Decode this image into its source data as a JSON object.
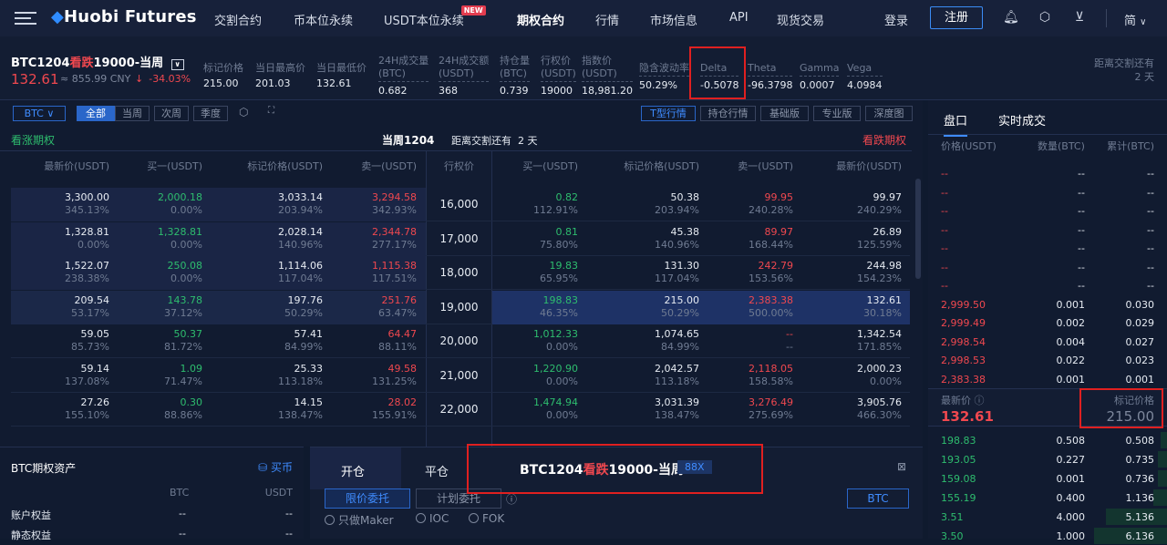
{
  "nav": {
    "logo": "Huobi Futures",
    "items": [
      "交割合约",
      "币本位永续",
      "USDT本位永续",
      "期权合约",
      "行情",
      "市场信息",
      "API",
      "现货交易"
    ],
    "new_badge": "NEW",
    "login": "登录",
    "register": "注册",
    "lang": "简"
  },
  "info": {
    "symbol_prefix": "BTC1204",
    "symbol_type": "看跌",
    "symbol_suffix": "19000-当周",
    "price": "132.61",
    "cny": "≈ 855.99 CNY",
    "change": "-34.03%",
    "stats": [
      {
        "label": "标记价格",
        "value": "215.00"
      },
      {
        "label": "当日最高价",
        "value": "201.03"
      },
      {
        "label": "当日最低价",
        "value": "132.61"
      },
      {
        "label": "24H成交量",
        "label2": "(BTC)",
        "value": "0.682"
      },
      {
        "label": "24H成交额",
        "label2": "(USDT)",
        "value": "368"
      },
      {
        "label": "持仓量",
        "label2": "(BTC)",
        "value": "0.739"
      },
      {
        "label": "行权价",
        "label2": "(USDT)",
        "value": "19000"
      },
      {
        "label": "指数价",
        "label2": "(USDT)",
        "value": "18,981.20"
      },
      {
        "label": "隐含波动率",
        "value": "50.29%"
      },
      {
        "label": "Delta",
        "value": "-0.5078"
      },
      {
        "label": "Theta",
        "value": "-96.3798"
      },
      {
        "label": "Gamma",
        "value": "0.0007"
      },
      {
        "label": "Vega",
        "value": "4.0984"
      }
    ],
    "dist_label": "距离交割还有",
    "dist_value": "2 天"
  },
  "filters": {
    "asset": "BTC",
    "periods": [
      "全部",
      "当周",
      "次周",
      "季度"
    ],
    "views": [
      "T型行情",
      "持仓行情",
      "基础版",
      "专业版",
      "深度图"
    ]
  },
  "board": {
    "call_title": "看涨期权",
    "put_title": "看跌期权",
    "center_title": "当周1204",
    "center_dist": "距离交割还有",
    "center_days": "2 天",
    "headers_left": [
      "最新价(USDT)",
      "买一(USDT)",
      "标记价格(USDT)",
      "卖一(USDT)"
    ],
    "header_strike": "行权价",
    "headers_right": [
      "买一(USDT)",
      "标记价格(USDT)",
      "卖一(USDT)",
      "最新价(USDT)"
    ],
    "rows": [
      {
        "strike": "16,000",
        "c": [
          [
            "3,300.00",
            "345.13%"
          ],
          [
            "2,000.18",
            "0.00%"
          ],
          [
            "3,033.14",
            "203.94%"
          ],
          [
            "3,294.58",
            "342.93%"
          ]
        ],
        "p": [
          [
            "0.82",
            "112.91%"
          ],
          [
            "50.38",
            "203.94%"
          ],
          [
            "99.95",
            "240.28%"
          ],
          [
            "99.97",
            "240.29%"
          ]
        ]
      },
      {
        "strike": "17,000",
        "c": [
          [
            "1,328.81",
            "0.00%"
          ],
          [
            "1,328.81",
            "0.00%"
          ],
          [
            "2,028.14",
            "140.96%"
          ],
          [
            "2,344.78",
            "277.17%"
          ]
        ],
        "p": [
          [
            "0.81",
            "75.80%"
          ],
          [
            "45.38",
            "140.96%"
          ],
          [
            "89.97",
            "168.44%"
          ],
          [
            "26.89",
            "125.59%"
          ]
        ]
      },
      {
        "strike": "18,000",
        "c": [
          [
            "1,522.07",
            "238.38%"
          ],
          [
            "250.08",
            "0.00%"
          ],
          [
            "1,114.06",
            "117.04%"
          ],
          [
            "1,115.38",
            "117.51%"
          ]
        ],
        "p": [
          [
            "19.83",
            "65.95%"
          ],
          [
            "131.30",
            "117.04%"
          ],
          [
            "242.79",
            "153.56%"
          ],
          [
            "244.98",
            "154.23%"
          ]
        ]
      },
      {
        "strike": "19,000",
        "c": [
          [
            "209.54",
            "53.17%"
          ],
          [
            "143.78",
            "37.12%"
          ],
          [
            "197.76",
            "50.29%"
          ],
          [
            "251.76",
            "63.47%"
          ]
        ],
        "p": [
          [
            "198.83",
            "46.35%"
          ],
          [
            "215.00",
            "50.29%"
          ],
          [
            "2,383.38",
            "500.00%"
          ],
          [
            "132.61",
            "30.18%"
          ]
        ]
      },
      {
        "strike": "20,000",
        "c": [
          [
            "59.05",
            "85.73%"
          ],
          [
            "50.37",
            "81.72%"
          ],
          [
            "57.41",
            "84.99%"
          ],
          [
            "64.47",
            "88.11%"
          ]
        ],
        "p": [
          [
            "1,012.33",
            "0.00%"
          ],
          [
            "1,074.65",
            "84.99%"
          ],
          [
            "--",
            "--"
          ],
          [
            "1,342.54",
            "171.85%"
          ]
        ]
      },
      {
        "strike": "21,000",
        "c": [
          [
            "59.14",
            "137.08%"
          ],
          [
            "1.09",
            "71.47%"
          ],
          [
            "25.33",
            "113.18%"
          ],
          [
            "49.58",
            "131.25%"
          ]
        ],
        "p": [
          [
            "1,220.90",
            "0.00%"
          ],
          [
            "2,042.57",
            "113.18%"
          ],
          [
            "2,118.05",
            "158.58%"
          ],
          [
            "2,000.23",
            "0.00%"
          ]
        ]
      },
      {
        "strike": "22,000",
        "c": [
          [
            "27.26",
            "155.10%"
          ],
          [
            "0.30",
            "88.86%"
          ],
          [
            "14.15",
            "138.47%"
          ],
          [
            "28.02",
            "155.91%"
          ]
        ],
        "p": [
          [
            "1,474.94",
            "0.00%"
          ],
          [
            "3,031.39",
            "138.47%"
          ],
          [
            "3,276.49",
            "275.69%"
          ],
          [
            "3,905.76",
            "466.30%"
          ]
        ]
      }
    ]
  },
  "orderbook": {
    "tabs": [
      "盘口",
      "实时成交"
    ],
    "headers": [
      "价格(USDT)",
      "数量(BTC)",
      "累计(BTC)"
    ],
    "asks": [
      [
        "--",
        "--",
        "--"
      ],
      [
        "--",
        "--",
        "--"
      ],
      [
        "--",
        "--",
        "--"
      ],
      [
        "--",
        "--",
        "--"
      ],
      [
        "--",
        "--",
        "--"
      ],
      [
        "--",
        "--",
        "--"
      ],
      [
        "--",
        "--",
        "--"
      ],
      [
        "2,999.50",
        "0.001",
        "0.030"
      ],
      [
        "2,999.49",
        "0.002",
        "0.029"
      ],
      [
        "2,998.54",
        "0.004",
        "0.027"
      ],
      [
        "2,998.53",
        "0.022",
        "0.023"
      ],
      [
        "2,383.38",
        "0.001",
        "0.001"
      ]
    ],
    "last_label": "最新价",
    "last_value": "132.61",
    "mark_label": "标记价格",
    "mark_value": "215.00",
    "bids": [
      [
        "198.83",
        "0.508",
        "0.508"
      ],
      [
        "193.05",
        "0.227",
        "0.735"
      ],
      [
        "159.08",
        "0.001",
        "0.736"
      ],
      [
        "155.19",
        "0.400",
        "1.136"
      ],
      [
        "3.51",
        "4.000",
        "5.136"
      ],
      [
        "3.50",
        "1.000",
        "6.136"
      ]
    ]
  },
  "assets": {
    "title": "BTC期权资产",
    "buy": "买币",
    "col1": "BTC",
    "col2": "USDT",
    "rows": [
      [
        "账户权益",
        "--",
        "--"
      ],
      [
        "静态权益",
        "--",
        "--"
      ]
    ]
  },
  "trade": {
    "tabs": [
      "开仓",
      "平仓"
    ],
    "contract_prefix": "BTC1204",
    "contract_type": "看跌",
    "contract_suffix": "19000-当周",
    "leverage": "88X",
    "order_types": [
      "限价委托",
      "计划委托"
    ],
    "currency": "BTC",
    "options": [
      "只做Maker",
      "IOC",
      "FOK"
    ]
  }
}
